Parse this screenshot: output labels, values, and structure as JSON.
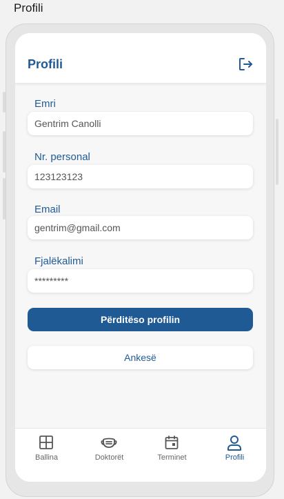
{
  "page_label": "Profili",
  "header": {
    "title": "Profili",
    "logout_icon": "logout-icon"
  },
  "form": {
    "name": {
      "label": "Emri",
      "value": "Gentrim Canolli"
    },
    "personal_number": {
      "label": "Nr. personal",
      "value": "123123123"
    },
    "email": {
      "label": "Email",
      "value": "gentrim@gmail.com"
    },
    "password": {
      "label": "Fjalëkalimi",
      "value": "*********"
    }
  },
  "buttons": {
    "update_label": "Përditëso profilin",
    "survey_label": "Ankesë"
  },
  "bottom_nav": {
    "items": [
      {
        "label": "Ballina",
        "icon": "grid-icon",
        "active": false
      },
      {
        "label": "Doktorët",
        "icon": "mask-icon",
        "active": false
      },
      {
        "label": "Terminet",
        "icon": "calendar-icon",
        "active": false
      },
      {
        "label": "Profili",
        "icon": "user-icon",
        "active": true
      }
    ]
  },
  "colors": {
    "accent": "#1f5a95",
    "background": "#f7f7f7",
    "inactive_icon": "#555555"
  }
}
